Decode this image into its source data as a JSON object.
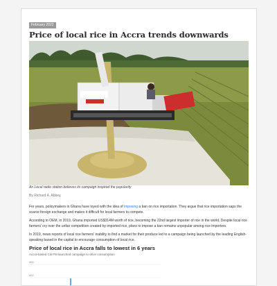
{
  "article": {
    "date": "February 2022",
    "title": "Price of local rice in Accra trends downwards",
    "caption": "An Local radio station believes its campaign inspired the popularity",
    "byline": "By Richard A. Abbey",
    "para1_before": "For years, policymakers in Ghana have toyed with the idea of ",
    "para1_link": "imposing",
    "para1_after": " a ban on rice importation. They argue that rice importation saps the scarce foreign exchange and makes it difficult for local farmers to compete.",
    "para2": "According to OEM, in 2019, Ghana imported US$314M worth of rice, becoming the 22nd largest importer of rice in the world. Despite local rice farmers' cry over the unfair competition created by imported rice, plans to impose a ban remains unpopular among rice importers.",
    "para3": "In 2019, news reports of local rice farmers' inability to find a market for their produce led to a campaign being launched by the leading English-speaking based in the capital to encourage consumption of local rice."
  },
  "chart": {
    "title": "Price of local rice in Accra falls to lowest in 6 years",
    "subtitle": "Accra-based Citi FM launched campaign to drive consumption",
    "tick_labels": [
      "400",
      "400"
    ]
  },
  "colors": {
    "accent": "#2a7fd0",
    "badge": "#9a9a9a"
  }
}
